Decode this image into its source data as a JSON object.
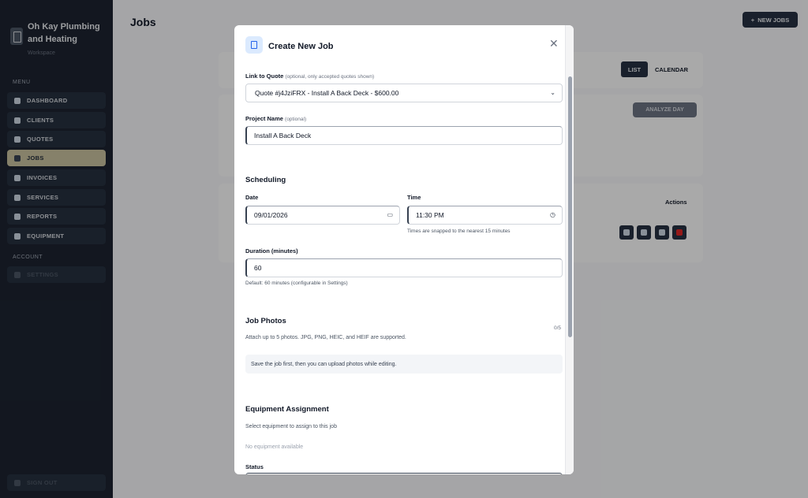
{
  "sidebar": {
    "brand_title": "Oh Kay Plumbing and Heating",
    "brand_subtitle": "Workspace",
    "menu_label": "MENU",
    "account_label": "ACCOUNT",
    "items": [
      {
        "label": "DASHBOARD",
        "icon": "info-icon"
      },
      {
        "label": "CLIENTS",
        "icon": "person-icon"
      },
      {
        "label": "QUOTES",
        "icon": "quote-icon"
      },
      {
        "label": "JOBS",
        "icon": "clipboard-icon",
        "active": true
      },
      {
        "label": "INVOICES",
        "icon": "invoice-icon"
      },
      {
        "label": "SERVICES",
        "icon": "wrench-icon"
      },
      {
        "label": "REPORTS",
        "icon": "chart-icon"
      },
      {
        "label": "EQUIPMENT",
        "icon": "toolbox-icon"
      }
    ],
    "settings_label": "SETTINGS",
    "signout_label": "SIGN OUT"
  },
  "main": {
    "title": "Jobs",
    "new_button": "NEW JOBS",
    "view_list": "LIST",
    "view_calendar": "CALENDAR",
    "analyze_button": "ANALYZE DAY",
    "actions_header": "Actions"
  },
  "modal": {
    "title": "Create New Job",
    "link_label": "Link to Quote",
    "link_hint": "(optional, only accepted quotes shown)",
    "link_value": "Quote #j4JziFRX - Install A Back Deck - $600.00",
    "project_label": "Project Name",
    "project_hint": "(optional)",
    "project_value": "Install A Back Deck",
    "scheduling_title": "Scheduling",
    "date_label": "Date",
    "date_value": "09/01/2026",
    "time_label": "Time",
    "time_value": "11:30 PM",
    "time_note": "Times are snapped to the nearest 15 minutes",
    "duration_label": "Duration (minutes)",
    "duration_value": "60",
    "duration_note": "Default: 60 minutes (configurable in Settings)",
    "photos_title": "Job Photos",
    "photos_count": "0/5",
    "photos_desc": "Attach up to 5 photos. JPG, PNG, HEIC, and HEIF are supported.",
    "photos_info": "Save the job first, then you can upload photos while editing.",
    "equipment_title": "Equipment Assignment",
    "equipment_desc": "Select equipment to assign to this job",
    "equipment_empty": "No equipment available",
    "status_label": "Status"
  },
  "colors": {
    "sidebar_bg": "#1c2330",
    "active_nav": "#c6bf9d",
    "primary_dark": "#253041",
    "modal_icon_bg": "#dbeafe",
    "danger": "#dc2626"
  }
}
